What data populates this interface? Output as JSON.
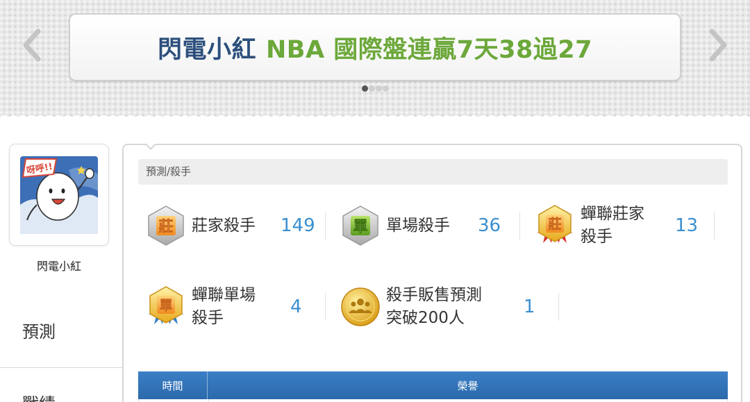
{
  "banner": {
    "name": "閃電小紅",
    "headline": "NBA 國際盤連贏7天38過27",
    "dots": 4,
    "active_dot": 1
  },
  "profile": {
    "avatar_caption": "呀呼!!",
    "username": "閃電小紅"
  },
  "side_nav": [
    {
      "label": "預測"
    },
    {
      "label": "戰績"
    }
  ],
  "section": {
    "title": "預測/殺手"
  },
  "stats": [
    {
      "label_lines": [
        "莊家殺手"
      ],
      "badge_char": "莊",
      "count": "149",
      "badge": "silver-badge"
    },
    {
      "label_lines": [
        "單場殺手"
      ],
      "badge_char": "單",
      "count": "36",
      "badge": "green-badge"
    },
    {
      "label_lines": [
        "蟬聯莊家",
        "殺手"
      ],
      "badge_char": "莊",
      "count": "13",
      "badge": "gold-ribbon-badge"
    },
    {
      "label_lines": [
        "蟬聯單場",
        "殺手"
      ],
      "badge_char": "單",
      "count": "4",
      "badge": "gold-ribbon-badge"
    },
    {
      "label_lines": [
        "殺手販售預測",
        "突破200人"
      ],
      "badge_char": "",
      "count": "1",
      "badge": "gold-coin-people"
    }
  ],
  "table": {
    "headers": [
      "時間",
      "榮譽"
    ]
  },
  "colors": {
    "accent_blue": "#3a8fcf",
    "banner_name": "#2c4f7c",
    "banner_headline": "#6ca83a",
    "table_header": "#2f72b8"
  }
}
